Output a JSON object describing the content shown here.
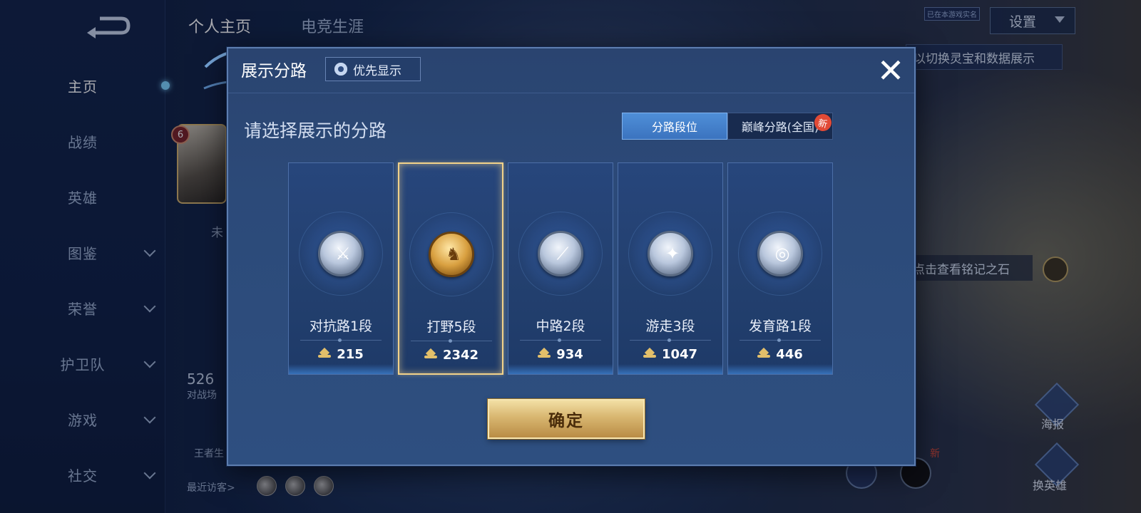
{
  "background": {
    "nav_items": [
      {
        "label": "主页",
        "active": true,
        "has_chevron": false
      },
      {
        "label": "战绩",
        "active": false,
        "has_chevron": false
      },
      {
        "label": "英雄",
        "active": false,
        "has_chevron": false
      },
      {
        "label": "图鉴",
        "active": false,
        "has_chevron": true
      },
      {
        "label": "荣誉",
        "active": false,
        "has_chevron": true
      },
      {
        "label": "护卫队",
        "active": false,
        "has_chevron": true
      },
      {
        "label": "游戏",
        "active": false,
        "has_chevron": true
      },
      {
        "label": "社交",
        "active": false,
        "has_chevron": true
      }
    ],
    "top_tabs": [
      {
        "label": "个人主页",
        "active": true
      },
      {
        "label": "电竞生涯",
        "active": false
      }
    ],
    "settings_label": "设置",
    "realname_badge": "已在本游戏实名",
    "hint_text": "以切换灵宝和数据展示",
    "stone_hint": "点击查看铭记之石",
    "level": "6",
    "partial_status": "未",
    "stat_number": "526",
    "stat_label": "对战场",
    "king_label": "王者生",
    "recent_visitors": "最近访客>",
    "right_labels": [
      "海报",
      "换英雄"
    ],
    "right_new": "新"
  },
  "modal": {
    "title": "展示分路",
    "priority_label": "优先显示",
    "close_symbol": "✕",
    "subtitle": "请选择展示的分路",
    "segments": [
      {
        "label": "分路段位",
        "active": true
      },
      {
        "label": "巅峰分路(全国)",
        "active": false
      }
    ],
    "new_badge": "新",
    "lanes": [
      {
        "rank": "对抗路1段",
        "points": "215",
        "selected": false,
        "medal": "silver",
        "icon": "sword-icon",
        "glyph": "⚔"
      },
      {
        "rank": "打野5段",
        "points": "2342",
        "selected": true,
        "medal": "gold",
        "icon": "dragon-icon",
        "glyph": "♞"
      },
      {
        "rank": "中路2段",
        "points": "934",
        "selected": false,
        "medal": "silver",
        "icon": "staff-icon",
        "glyph": "⟋"
      },
      {
        "rank": "游走3段",
        "points": "1047",
        "selected": false,
        "medal": "silver",
        "icon": "wings-icon",
        "glyph": "✦"
      },
      {
        "rank": "发育路1段",
        "points": "446",
        "selected": false,
        "medal": "silver",
        "icon": "target-icon",
        "glyph": "◎"
      }
    ],
    "confirm_label": "确定"
  },
  "colors": {
    "gold_accent": "#f2d28a",
    "active_segment": "#4f8fd8",
    "modal_bg": "#2c4a79"
  }
}
